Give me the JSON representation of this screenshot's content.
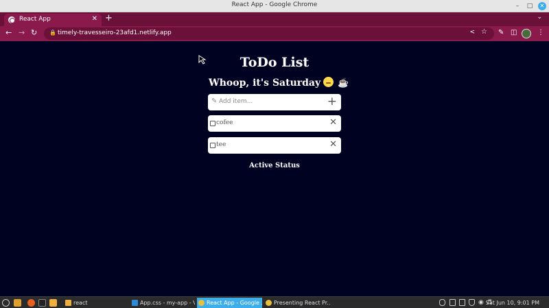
{
  "window": {
    "title": "React App - Google Chrome"
  },
  "tabs": [
    {
      "label": "React App",
      "active": true
    }
  ],
  "toolbar": {
    "url": "timely-travesseiro-23afd1.netlify.app"
  },
  "app": {
    "title": "ToDo List",
    "day_message": "Whoop, it's Saturday",
    "add_placeholder": "Add item...",
    "items": [
      {
        "text": "cofee",
        "checked": false
      },
      {
        "text": "tee",
        "checked": false
      }
    ],
    "status": "Active Status"
  },
  "taskbar": {
    "tasks": [
      {
        "label": "react",
        "active": false
      },
      {
        "label": "App.css - my-app - V...",
        "active": false
      },
      {
        "label": "React App - Google ...",
        "active": true
      },
      {
        "label": "Presenting React Pr...",
        "active": false
      }
    ],
    "clock": "Sat Jun 10,  9:01 PM"
  },
  "colors": {
    "page_bg": "#000222",
    "browser_accent": "#8a1a4c",
    "taskbar_active": "#3daee9"
  }
}
